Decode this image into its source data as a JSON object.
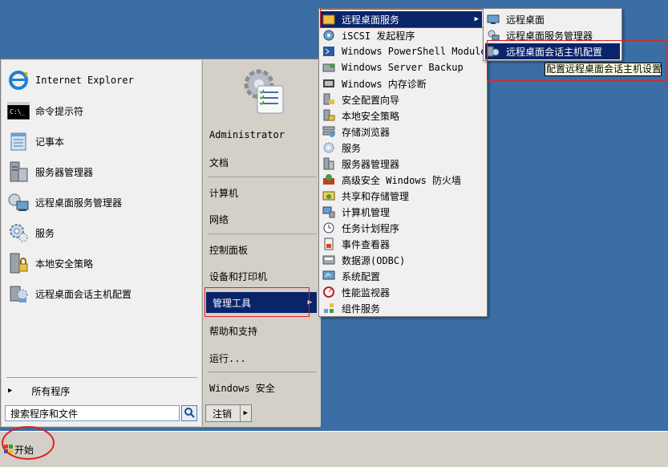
{
  "start_menu": {
    "pinned": [
      {
        "label": "Internet Explorer",
        "icon": "internet-explorer-icon"
      },
      {
        "label": "命令提示符",
        "icon": "command-prompt-icon"
      },
      {
        "label": "记事本",
        "icon": "notepad-icon"
      },
      {
        "label": "服务器管理器",
        "icon": "server-manager-icon"
      },
      {
        "label": "远程桌面服务管理器",
        "icon": "remote-desktop-manager-icon"
      },
      {
        "label": "服务",
        "icon": "services-icon"
      },
      {
        "label": "本地安全策略",
        "icon": "local-security-policy-icon"
      },
      {
        "label": "远程桌面会话主机配置",
        "icon": "rd-session-host-config-icon"
      }
    ],
    "all_programs": "所有程序",
    "search_placeholder": "搜索程序和文件",
    "right": {
      "user": "Administrator",
      "items": [
        "文档",
        "计算机",
        "网络",
        "控制面板",
        "设备和打印机",
        "管理工具",
        "帮助和支持",
        "运行...",
        "Windows 安全"
      ],
      "logoff": "注销"
    }
  },
  "admin_tools_menu": [
    {
      "label": "远程桌面服务",
      "icon": "folder-icon"
    },
    {
      "label": "iSCSI 发起程序",
      "icon": "iscsi-icon"
    },
    {
      "label": "Windows PowerShell Modules",
      "icon": "powershell-icon"
    },
    {
      "label": "Windows Server Backup",
      "icon": "backup-icon"
    },
    {
      "label": "Windows 内存诊断",
      "icon": "memory-diagnostic-icon"
    },
    {
      "label": "安全配置向导",
      "icon": "security-wizard-icon"
    },
    {
      "label": "本地安全策略",
      "icon": "local-security-policy-icon"
    },
    {
      "label": "存储浏览器",
      "icon": "storage-explorer-icon"
    },
    {
      "label": "服务",
      "icon": "services-icon"
    },
    {
      "label": "服务器管理器",
      "icon": "server-manager-icon"
    },
    {
      "label": "高级安全 Windows 防火墙",
      "icon": "firewall-icon"
    },
    {
      "label": "共享和存储管理",
      "icon": "share-storage-icon"
    },
    {
      "label": "计算机管理",
      "icon": "computer-management-icon"
    },
    {
      "label": "任务计划程序",
      "icon": "task-scheduler-icon"
    },
    {
      "label": "事件查看器",
      "icon": "event-viewer-icon"
    },
    {
      "label": "数据源(ODBC)",
      "icon": "odbc-icon"
    },
    {
      "label": "系统配置",
      "icon": "system-config-icon"
    },
    {
      "label": "性能监视器",
      "icon": "performance-monitor-icon"
    },
    {
      "label": "组件服务",
      "icon": "component-services-icon"
    }
  ],
  "remote_desktop_menu": [
    {
      "label": "远程桌面",
      "icon": "remote-desktop-icon"
    },
    {
      "label": "远程桌面服务管理器",
      "icon": "remote-desktop-manager-icon"
    },
    {
      "label": "远程桌面会话主机配置",
      "icon": "rd-session-host-config-icon"
    }
  ],
  "tooltip": "配置远程桌面会话主机设置",
  "taskbar": {
    "start_label": "开始"
  },
  "colors": {
    "desktop": "#3a6ea5",
    "highlight": "#0a246a",
    "annotation": "#e02020"
  }
}
